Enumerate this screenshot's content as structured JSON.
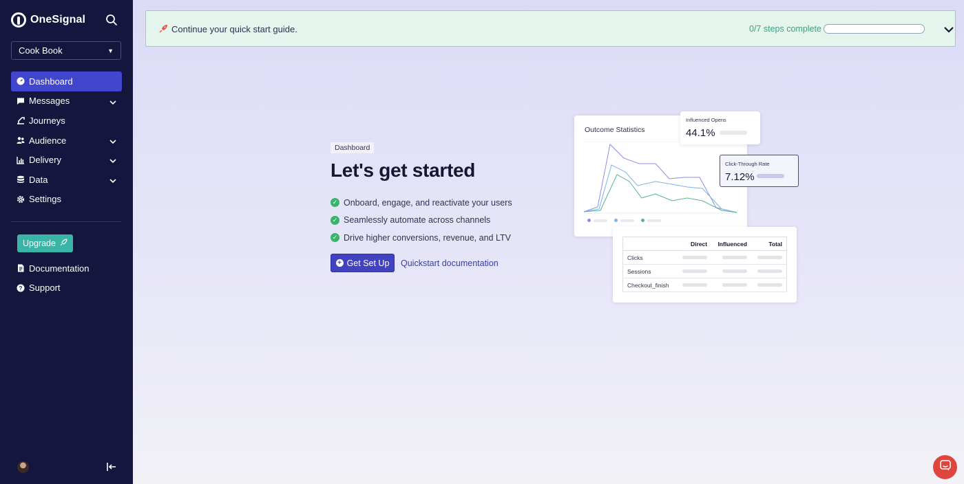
{
  "sidebar": {
    "brand": "OneSignal",
    "app_selector": {
      "value": "Cook Book"
    },
    "nav": [
      {
        "label": "Dashboard",
        "icon": "dashboard-icon",
        "active": true,
        "expandable": false
      },
      {
        "label": "Messages",
        "icon": "message-icon",
        "active": false,
        "expandable": true
      },
      {
        "label": "Journeys",
        "icon": "journey-icon",
        "active": false,
        "expandable": false
      },
      {
        "label": "Audience",
        "icon": "people-icon",
        "active": false,
        "expandable": true
      },
      {
        "label": "Delivery",
        "icon": "bar-chart-icon",
        "active": false,
        "expandable": true
      },
      {
        "label": "Data",
        "icon": "database-icon",
        "active": false,
        "expandable": true
      },
      {
        "label": "Settings",
        "icon": "gear-icon",
        "active": false,
        "expandable": false
      }
    ],
    "upgrade_label": "Upgrade",
    "links": [
      {
        "label": "Documentation",
        "icon": "document-icon"
      },
      {
        "label": "Support",
        "icon": "help-icon"
      }
    ]
  },
  "quickstart": {
    "text": "Continue your quick start guide.",
    "steps_text": "0/7 steps complete",
    "progress": 0
  },
  "hero": {
    "tag": "Dashboard",
    "title": "Let's get started",
    "features": [
      "Onboard, engage, and reactivate your users",
      "Seamlessly automate across channels",
      "Drive higher conversions, revenue, and LTV"
    ],
    "cta_label": "Get Set Up",
    "docs_link": "Quickstart documentation"
  },
  "illustration": {
    "outcome_title": "Outcome Statistics",
    "opens_label": "Influenced Opens",
    "opens_value": "44.1%",
    "ctr_label": "Click-Through Rate",
    "ctr_value": "7.12%",
    "table": {
      "headers": [
        "",
        "Direct",
        "Influenced",
        "Total"
      ],
      "rows": [
        "Clicks",
        "Sessions",
        "Checkout_finish"
      ]
    }
  },
  "colors": {
    "sidebar_bg": "#15163d",
    "accent": "#4246cf",
    "upgrade": "#3ab4a6",
    "success": "#36a67f",
    "chat": "#e0453d"
  }
}
